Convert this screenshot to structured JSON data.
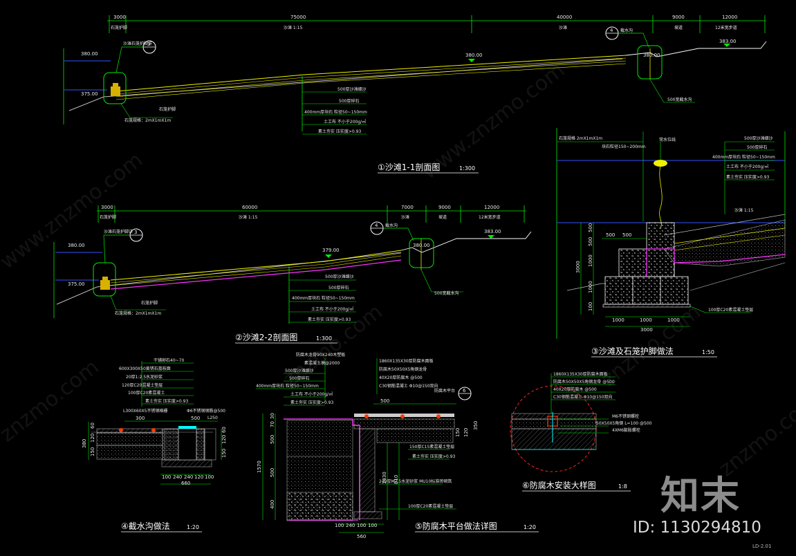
{
  "colors": {
    "background": "#000000",
    "dimension": "#e8e8e8",
    "green": "#00ee00",
    "yellow": "#f0f000",
    "magenta": "#ff33ff",
    "water": "#3355ff",
    "cyan": "#00ffff",
    "title": "#ffffff",
    "red": "#ff2020"
  },
  "s1": {
    "title": "①沙滩1-1剖面图",
    "scale": "1:300",
    "dims": [
      "3000",
      "75000",
      "40000",
      "9000",
      "12000"
    ],
    "dimlabels": [
      "石笼护脚",
      "沙滩 1:15",
      "沙滩",
      "坡道",
      "12米宽步道"
    ],
    "levels": [
      "380.00",
      "375.00",
      "380.00",
      "380.00",
      "383.00"
    ],
    "markers": [
      "3",
      "4"
    ],
    "marker_notes": [
      "沙滩石笼护脚详",
      "截水沟"
    ],
    "notes": [
      "500厚沙滩细沙",
      "500厚碎石",
      "400mm厚块石 粒径50~150mm",
      "土工布 不小于200g/㎡",
      "素土夯实 压实度>0.93"
    ],
    "left_notes": [
      "石笼护脚",
      "石笼规格：2mX1mX1m"
    ],
    "right_note": "500宽截水沟"
  },
  "s2": {
    "title": "②沙滩2-2剖面图",
    "scale": "1:300",
    "dims": [
      "3000",
      "60000",
      "7000",
      "9000",
      "12000"
    ],
    "dimlabels": [
      "石笼护脚",
      "沙滩 1:15",
      "沙滩",
      "坡道",
      "12米宽步道"
    ],
    "levels": [
      "380.00",
      "375.00",
      "379.00",
      "380.00",
      "383.00"
    ],
    "markers": [
      "3",
      "4"
    ],
    "marker_notes": [
      "沙滩石笼护脚详",
      "截水沟"
    ],
    "notes": [
      "500厚沙滩细沙",
      "500厚碎石",
      "400mm厚块石 粒径50~150mm",
      "土工布 不小于200g/㎡",
      "素土夯实 压实度>0.93"
    ],
    "left_notes": [
      "石笼护脚",
      "石笼规格：2mX1mX1m"
    ],
    "right_note": "500宽截水沟"
  },
  "s3": {
    "title": "③沙滩及石笼护脚做法",
    "scale": "1:50",
    "top_notes": [
      "石笼规格 2mX1mX1m",
      "块石粒径150~200mm",
      "常水位线"
    ],
    "right_notes": [
      "500厚沙滩细沙",
      "500厚碎石",
      "400mm厚块石 粒径50~150mm",
      "土工布 不小于200g/㎡",
      "素土夯实 压实度>0.93",
      "沙滩 1:15"
    ],
    "left_dims": [
      "500",
      "500",
      "1000",
      "1000",
      "1000",
      "100"
    ],
    "vert_total": "3000",
    "top_dims": [
      "500",
      "500"
    ],
    "bottom_dims": [
      "1000",
      "1000",
      "1000"
    ],
    "bottom_total": "3000",
    "base_note": "100厚C20素混凝土垫层"
  },
  "s4": {
    "title": "④截水沟做法",
    "scale": "1:20",
    "notes": [
      "干铺卵石40~70",
      "600X300X50黄锈石荔枝面",
      "20厚1:2.5水泥砂浆",
      "120厚C20混凝土垫层",
      "100厚C20素混凝土",
      "素土夯实 压实度>0.93"
    ],
    "grate_notes": [
      "L300X60X5不锈钢格栅",
      "Φ6不锈钢钢筋@500",
      "L250"
    ],
    "dims_bottom": [
      "100",
      "240",
      "240",
      "120",
      "100"
    ],
    "total": "660",
    "dims_left": [
      "380",
      "150",
      "120",
      "60"
    ],
    "dims_top": [
      "300",
      "500"
    ],
    "dims_right": [
      "60",
      "120",
      "150",
      "50"
    ]
  },
  "s5": {
    "title": "⑤防腐木平台做法详图",
    "scale": "1:20",
    "notes_top": [
      "防腐木龙骨90X240木塑板",
      "素混凝土墩@2000"
    ],
    "notes_left": [
      "500厚沙滩细沙",
      "500厚碎石",
      "400mm厚块石 粒径50~150mm",
      "土工布 不小于200g/㎡",
      "素土夯实 压实度>0.93"
    ],
    "notes_right": [
      "1860X135X30厚防腐木面板",
      "防腐木50X50X5角钢龙骨",
      "40X20厚防腐木 @500",
      "C30钢筋混凝土 Φ10@150双向"
    ],
    "inner_notes": [
      "150厚C15素混凝土垫层",
      "素土夯实 压实度>0.93",
      "240厚M7.5水泥砂浆 MU10标准砖砌筑",
      "100厚C20素混凝土垫层"
    ],
    "dims_left": [
      "1570",
      "500",
      "500",
      "400",
      "30",
      "70"
    ],
    "dims_right": [
      "1430",
      "810",
      "150",
      "120",
      "350"
    ],
    "dims_bottom": [
      "100",
      "240",
      "100",
      "100"
    ],
    "total": "560",
    "top_dim": "500",
    "marker": "6",
    "marker_note": "防腐木平台"
  },
  "s6": {
    "title": "⑥防腐木安装大样图",
    "scale": "1:8",
    "notes": [
      "1860X135X30厚防腐木面板",
      "防腐木50X50X5角钢龙骨 @500",
      "40X20厚防腐木 @500",
      "C30钢筋混凝土 Φ10@150双向"
    ],
    "side_notes": [
      "M6不锈钢螺栓",
      "50X50X5角钢 L=100 @500",
      "4XM6膨胀螺栓"
    ]
  },
  "watermark": {
    "logo": "知末",
    "id": "ID: 1130294810",
    "site": "www.znzmo.com",
    "site2": "znzmo.com"
  },
  "corner": "LD-2.01"
}
